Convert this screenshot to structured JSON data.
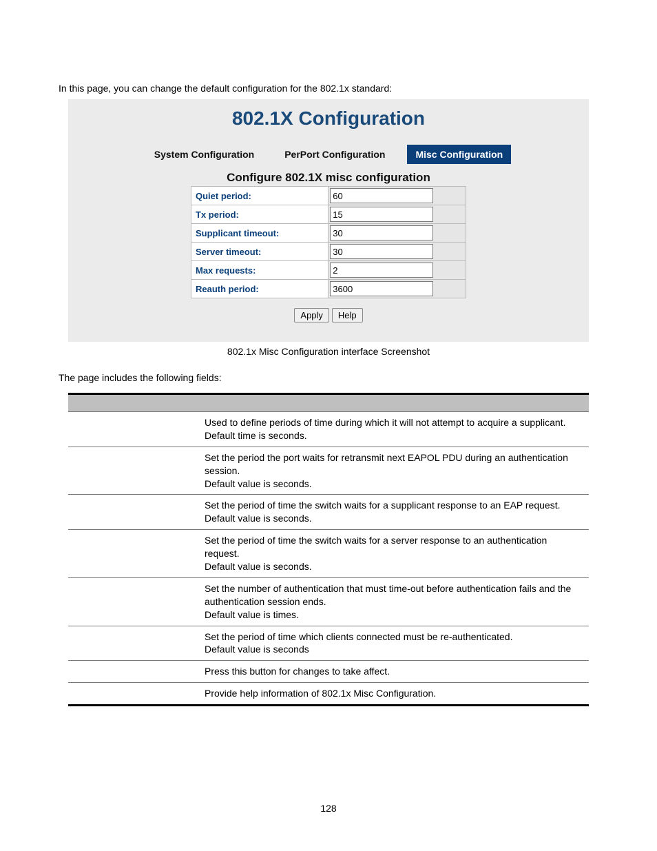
{
  "intro": "In this page, you can change the default configuration for the 802.1x standard:",
  "panel_title": "802.1X Configuration",
  "tabs": {
    "system": "System Configuration",
    "perport": "PerPort Configuration",
    "misc": "Misc Configuration"
  },
  "subhead": "Configure 802.1X misc configuration",
  "form": {
    "quiet_period": {
      "label": "Quiet period:",
      "value": "60"
    },
    "tx_period": {
      "label": "Tx period:",
      "value": "15"
    },
    "supplicant_timeout": {
      "label": "Supplicant timeout:",
      "value": "30"
    },
    "server_timeout": {
      "label": "Server timeout:",
      "value": "30"
    },
    "max_requests": {
      "label": "Max requests:",
      "value": "2"
    },
    "reauth_period": {
      "label": "Reauth period:",
      "value": "3600"
    }
  },
  "buttons": {
    "apply": "Apply",
    "help": "Help"
  },
  "caption": "802.1x Misc Configuration interface Screenshot",
  "fields_intro": "The page includes the following fields:",
  "desc": {
    "r0": "Used to define periods of time during which it will not attempt to acquire a supplicant.\nDefault time is     seconds.",
    "r1": "Set the period the port waits for retransmit next EAPOL PDU during an authentication session.\nDefault value is     seconds.",
    "r2": "Set the period of time the switch waits for a supplicant response to an EAP request.\nDefault value is     seconds.",
    "r3": "Set the period of time the switch waits for a server response to an authentication request.\nDefault value is     seconds.",
    "r4": "Set the number of authentication that must time-out before authentication fails and the authentication session ends.\nDefault value is    times.",
    "r5": "Set the period of time which clients connected must be re-authenticated.\nDefault value is          seconds",
    "r6": "Press this button for changes to take affect.",
    "r7": "Provide help information of 802.1x Misc Configuration."
  },
  "page_number": "128"
}
